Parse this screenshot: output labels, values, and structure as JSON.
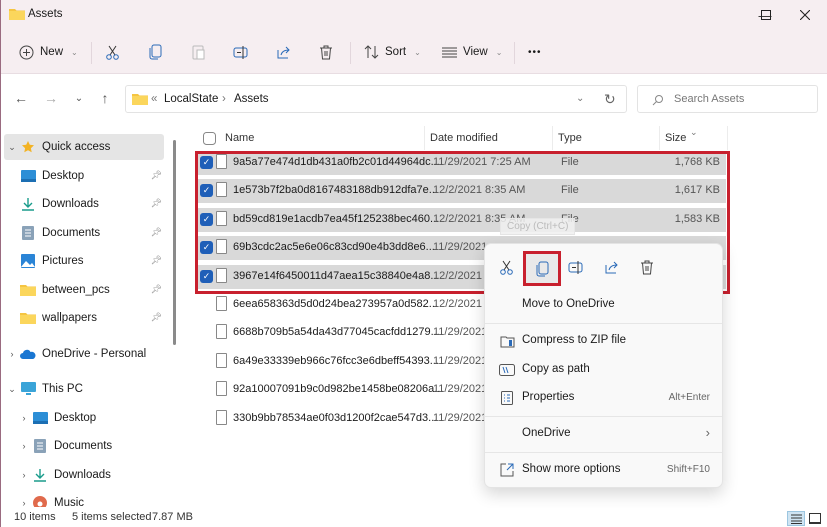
{
  "window": {
    "title": "Assets",
    "controls": {
      "minimize": "—",
      "maximize": "☐",
      "close": "✕"
    }
  },
  "commandbar": {
    "new_label": "New",
    "sort_label": "Sort",
    "view_label": "View",
    "more_label": "•••",
    "icons": [
      "plus-circle-icon",
      "cut-icon",
      "copy-icon",
      "paste-icon",
      "rename-icon",
      "share-icon",
      "delete-icon"
    ]
  },
  "navbar": {
    "back": "←",
    "forward": "→",
    "recent": "⌄",
    "up": "↑",
    "breadcrumb": {
      "overflow": "«",
      "items": [
        "LocalState",
        "Assets"
      ],
      "separator": "›"
    },
    "dropdown": "⌄",
    "refresh": "↻",
    "search_placeholder": "Search Assets"
  },
  "sidebar": {
    "quick_access": {
      "label": "Quick access",
      "items": [
        {
          "label": "Desktop",
          "icon": "desktop-icon"
        },
        {
          "label": "Downloads",
          "icon": "download-icon"
        },
        {
          "label": "Documents",
          "icon": "document-icon"
        },
        {
          "label": "Pictures",
          "icon": "pictures-icon"
        },
        {
          "label": "between_pcs",
          "icon": "folder-icon"
        },
        {
          "label": "wallpapers",
          "icon": "folder-icon"
        }
      ]
    },
    "onedrive": {
      "label": "OneDrive - Personal"
    },
    "this_pc": {
      "label": "This PC",
      "items": [
        {
          "label": "Desktop"
        },
        {
          "label": "Documents"
        },
        {
          "label": "Downloads"
        },
        {
          "label": "Music"
        }
      ]
    }
  },
  "filelist": {
    "columns": {
      "name": "Name",
      "date": "Date modified",
      "type": "Type",
      "size": "Size"
    },
    "rows": [
      {
        "name": "9a5a77e474d1db431a0fb2c01d44964dc...",
        "date": "11/29/2021 7:25 AM",
        "type": "File",
        "size": "1,768 KB",
        "selected": true
      },
      {
        "name": "1e573b7f2ba0d8167483188db912dfa7e...",
        "date": "12/2/2021 8:35 AM",
        "type": "File",
        "size": "1,617 KB",
        "selected": true
      },
      {
        "name": "bd59cd819e1acdb7ea45f125238bec460...",
        "date": "12/2/2021 8:35 AM",
        "type": "File",
        "size": "1,583 KB",
        "selected": true
      },
      {
        "name": "69b3cdc2ac5e6e06c83cd90e4b3dd8e6...",
        "date": "11/29/2021",
        "type": "",
        "size": "",
        "selected": true
      },
      {
        "name": "3967e14f6450011d47aea15c38840e4a8...",
        "date": "12/2/2021 8",
        "type": "",
        "size": "",
        "selected": true
      },
      {
        "name": "6eea658363d5d0d24bea273957a0d582...",
        "date": "12/2/2021 8",
        "type": "",
        "size": "",
        "selected": false
      },
      {
        "name": "6688b709b5a54da43d77045cacfdd1279...",
        "date": "11/29/2021",
        "type": "",
        "size": "",
        "selected": false
      },
      {
        "name": "6a49e33339eb966c76fcc3e6dbeff54393...",
        "date": "11/29/2021",
        "type": "",
        "size": "",
        "selected": false
      },
      {
        "name": "92a10007091b9c0d982be1458be08206a...",
        "date": "11/29/2021",
        "type": "",
        "size": "",
        "selected": false
      },
      {
        "name": "330b9bb78534ae0f03d1200f2cae547d3...",
        "date": "11/29/2021",
        "type": "",
        "size": "",
        "selected": false
      }
    ]
  },
  "tooltip": "Copy (Ctrl+C)",
  "context_menu": {
    "quick_actions": [
      "cut-icon",
      "copy-icon",
      "rename-icon",
      "share-icon",
      "delete-icon"
    ],
    "highlighted_action": "copy",
    "items": [
      {
        "label": "Move to OneDrive",
        "shortcut": "",
        "icon": ""
      },
      {
        "label": "Compress to ZIP file",
        "shortcut": "",
        "icon": "zip-icon"
      },
      {
        "label": "Copy as path",
        "shortcut": "",
        "icon": "copy-path-icon"
      },
      {
        "label": "Properties",
        "shortcut": "Alt+Enter",
        "icon": "properties-icon"
      },
      {
        "label": "OneDrive",
        "shortcut": "›",
        "icon": ""
      },
      {
        "label": "Show more options",
        "shortcut": "Shift+F10",
        "icon": "more-options-icon"
      }
    ]
  },
  "status": {
    "count": "10 items",
    "selected": "5 items selected",
    "size": "7.87 MB"
  },
  "colors": {
    "accent": "#1f5fb8",
    "highlight_red": "#c8202e",
    "titlebar_bg": "#f6eef1",
    "selection_bg": "#d9d9d9"
  }
}
